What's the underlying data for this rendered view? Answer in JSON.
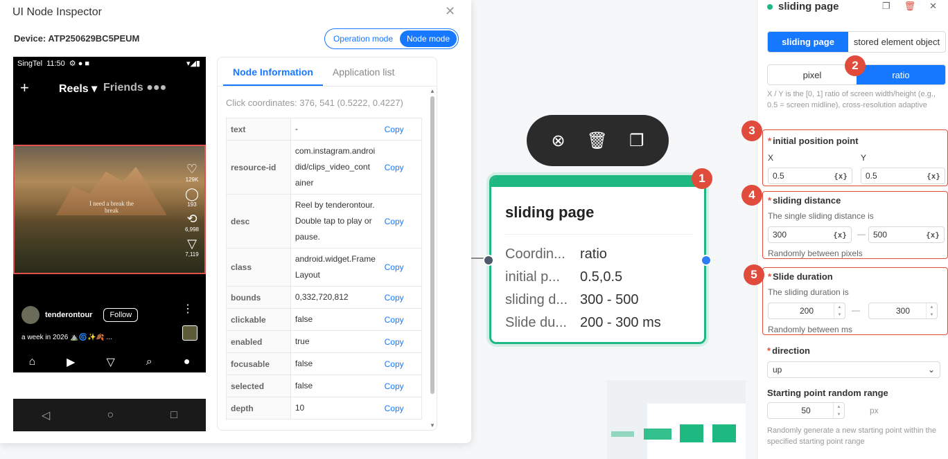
{
  "inspector": {
    "title": "UI Node Inspector",
    "device_label": "Device: ATP250629BC5PEUM",
    "mode_operation": "Operation mode",
    "mode_node": "Node mode",
    "phone": {
      "carrier": "SingTel",
      "time": "11:50",
      "reels": "Reels",
      "friends": "Friends",
      "video_caption": "I need a break\nthe break",
      "likes": "129K",
      "comments": "193",
      "reposts": "6,998",
      "shares": "7,119",
      "username": "tenderontour",
      "follow": "Follow",
      "caption": "a week in 2026 ⛰️🌀✨🍂 ..."
    },
    "tabs": [
      "Node Information",
      "Application list"
    ],
    "click_coordinates": "Click coordinates: 376, 541 (0.5222, 0.4227)",
    "copy_label": "Copy",
    "rows": [
      {
        "key": "text",
        "value": "-"
      },
      {
        "key": "resource-id",
        "value": "com.instagram.androi did/clips_video_cont ainer"
      },
      {
        "key": "desc",
        "value": "Reel by tenderontour. Double tap to play or pause."
      },
      {
        "key": "class",
        "value": "android.widget.Frame Layout"
      },
      {
        "key": "bounds",
        "value": "0,332,720,812"
      },
      {
        "key": "clickable",
        "value": "false"
      },
      {
        "key": "enabled",
        "value": "true"
      },
      {
        "key": "focusable",
        "value": "false"
      },
      {
        "key": "selected",
        "value": "false"
      },
      {
        "key": "depth",
        "value": "10"
      }
    ]
  },
  "node": {
    "title": "sliding page",
    "rows": [
      {
        "key": "Coordin...",
        "value": "ratio"
      },
      {
        "key": "initial p...",
        "value": "0.5,0.5"
      },
      {
        "key": "sliding d...",
        "value": "300 - 500"
      },
      {
        "key": "Slide du...",
        "value": "200 - 300 ms"
      }
    ]
  },
  "badges": [
    "1",
    "2",
    "3",
    "4",
    "5"
  ],
  "panel": {
    "title": "sliding page",
    "tab_active": "sliding page",
    "tab_other": "stored element object",
    "unit_pixel": "pixel",
    "unit_ratio": "ratio",
    "hint": "X / Y is the [0, 1] ratio of screen width/height (e.g., 0.5 = screen midline), cross-resolution adaptive",
    "initial_position_label": "initial position point",
    "x_label": "X",
    "y_label": "Y",
    "x_value": "0.5",
    "y_value": "0.5",
    "var_suffix": "{x}",
    "sliding_distance_label": "sliding distance",
    "sliding_distance_desc": "The single sliding distance is",
    "distance_min": "300",
    "distance_max": "500",
    "distance_note": "Randomly between pixels",
    "slide_duration_label": "Slide duration",
    "slide_duration_desc": "The sliding duration is",
    "duration_min": "200",
    "duration_max": "300",
    "duration_note": "Randomly between ms",
    "direction_label": "direction",
    "direction_value": "up",
    "random_range_label": "Starting point random range",
    "random_range_value": "50",
    "random_range_unit": "px",
    "random_range_hint": "Randomly generate a new starting point within the specified starting point range"
  },
  "colors": {
    "accent": "#1677ff",
    "node_green": "#1eb980",
    "badge_red": "#e14b3b"
  }
}
